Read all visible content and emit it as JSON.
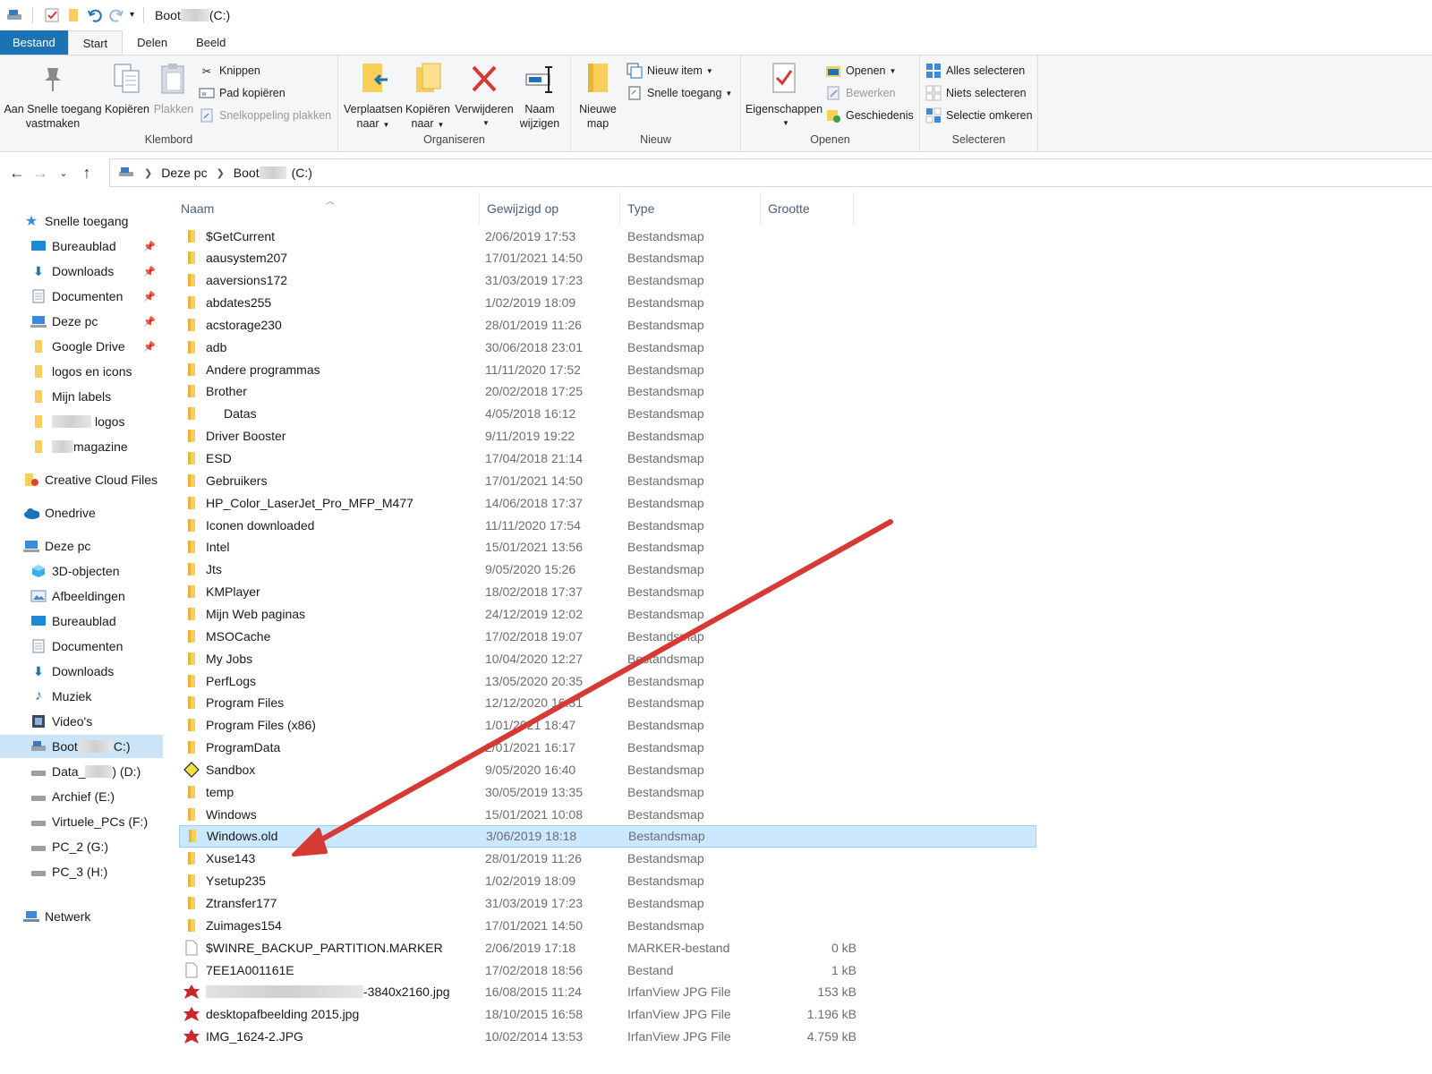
{
  "window": {
    "title_prefix": "Boot",
    "title_suffix": "(C:)"
  },
  "ribbon_tabs": [
    "Bestand",
    "Start",
    "Delen",
    "Beeld"
  ],
  "ribbon": {
    "klembord": {
      "label": "Klembord",
      "pin_line1": "Aan Snelle toegang",
      "pin_line2": "vastmaken",
      "copy": "Kopiëren",
      "paste": "Plakken",
      "cut": "Knippen",
      "copy_path": "Pad kopiëren",
      "paste_shortcut": "Snelkoppeling plakken"
    },
    "organiseren": {
      "label": "Organiseren",
      "move_line1": "Verplaatsen",
      "move_line2": "naar",
      "copyto_line1": "Kopiëren",
      "copyto_line2": "naar",
      "delete": "Verwijderen",
      "rename_line1": "Naam",
      "rename_line2": "wijzigen"
    },
    "nieuw": {
      "label": "Nieuw",
      "newfolder_line1": "Nieuwe",
      "newfolder_line2": "map",
      "new_item": "Nieuw item",
      "easy_access": "Snelle toegang"
    },
    "openen": {
      "label": "Openen",
      "properties": "Eigenschappen",
      "open": "Openen",
      "edit": "Bewerken",
      "history": "Geschiedenis"
    },
    "selecteren": {
      "label": "Selecteren",
      "select_all": "Alles selecteren",
      "select_none": "Niets selecteren",
      "invert": "Selectie omkeren"
    }
  },
  "address": {
    "crumb1": "Deze pc",
    "crumb2_prefix": "Boot",
    "crumb2_suffix": "(C:)"
  },
  "sidebar": {
    "quick_access": "Snelle toegang",
    "quick_items": [
      "Bureaublad",
      "Downloads",
      "Documenten",
      "Deze pc",
      "Google Drive",
      "logos en icons",
      "Mijn labels",
      "logos",
      "magazine"
    ],
    "creative_cloud": "Creative Cloud Files",
    "onedrive": "Onedrive",
    "this_pc": "Deze pc",
    "pc_items": [
      "3D-objecten",
      "Afbeeldingen",
      "Bureaublad",
      "Documenten",
      "Downloads",
      "Muziek",
      "Video's"
    ],
    "drives": [
      "Boot",
      "Data_",
      "Archief (E:)",
      "Virtuele_PCs (F:)",
      "PC_2 (G:)",
      "PC_3 (H:)"
    ],
    "drive_boot_suffix": "C:)",
    "drive_data_suffix": ") (D:)",
    "network": "Netwerk"
  },
  "columns": [
    "Naam",
    "Gewijzigd op",
    "Type",
    "Grootte"
  ],
  "files": [
    {
      "name": "$GetCurrent",
      "date": "2/06/2019 17:53",
      "type": "Bestandsmap",
      "size": ""
    },
    {
      "name": "aausystem207",
      "date": "17/01/2021 14:50",
      "type": "Bestandsmap",
      "size": ""
    },
    {
      "name": "aaversions172",
      "date": "31/03/2019 17:23",
      "type": "Bestandsmap",
      "size": ""
    },
    {
      "name": "abdates255",
      "date": "1/02/2019 18:09",
      "type": "Bestandsmap",
      "size": ""
    },
    {
      "name": "acstorage230",
      "date": "28/01/2019 11:26",
      "type": "Bestandsmap",
      "size": ""
    },
    {
      "name": "adb",
      "date": "30/06/2018 23:01",
      "type": "Bestandsmap",
      "size": ""
    },
    {
      "name": "Andere programmas",
      "date": "11/11/2020 17:52",
      "type": "Bestandsmap",
      "size": ""
    },
    {
      "name": "Brother",
      "date": "20/02/2018 17:25",
      "type": "Bestandsmap",
      "size": ""
    },
    {
      "name": "Datas",
      "date": "4/05/2018 16:12",
      "type": "Bestandsmap",
      "size": ""
    },
    {
      "name": "Driver Booster",
      "date": "9/11/2019 19:22",
      "type": "Bestandsmap",
      "size": ""
    },
    {
      "name": "ESD",
      "date": "17/04/2018 21:14",
      "type": "Bestandsmap",
      "size": ""
    },
    {
      "name": "Gebruikers",
      "date": "17/01/2021 14:50",
      "type": "Bestandsmap",
      "size": ""
    },
    {
      "name": "HP_Color_LaserJet_Pro_MFP_M477",
      "date": "14/06/2018 17:37",
      "type": "Bestandsmap",
      "size": ""
    },
    {
      "name": "Iconen downloaded",
      "date": "11/11/2020 17:54",
      "type": "Bestandsmap",
      "size": ""
    },
    {
      "name": "Intel",
      "date": "15/01/2021 13:56",
      "type": "Bestandsmap",
      "size": ""
    },
    {
      "name": "Jts",
      "date": "9/05/2020 15:26",
      "type": "Bestandsmap",
      "size": ""
    },
    {
      "name": "KMPlayer",
      "date": "18/02/2018 17:37",
      "type": "Bestandsmap",
      "size": ""
    },
    {
      "name": "Mijn Web paginas",
      "date": "24/12/2019 12:02",
      "type": "Bestandsmap",
      "size": ""
    },
    {
      "name": "MSOCache",
      "date": "17/02/2018 19:07",
      "type": "Bestandsmap",
      "size": ""
    },
    {
      "name": "My Jobs",
      "date": "10/04/2020 12:27",
      "type": "Bestandsmap",
      "size": ""
    },
    {
      "name": "PerfLogs",
      "date": "13/05/2020 20:35",
      "type": "Bestandsmap",
      "size": ""
    },
    {
      "name": "Program Files",
      "date": "12/12/2020 16:31",
      "type": "Bestandsmap",
      "size": ""
    },
    {
      "name": "Program Files (x86)",
      "date": "1/01/2021 18:47",
      "type": "Bestandsmap",
      "size": ""
    },
    {
      "name": "ProgramData",
      "date": "2/01/2021 16:17",
      "type": "Bestandsmap",
      "size": ""
    },
    {
      "name": "Sandbox",
      "date": "9/05/2020 16:40",
      "type": "Bestandsmap",
      "size": ""
    },
    {
      "name": "temp",
      "date": "30/05/2019 13:35",
      "type": "Bestandsmap",
      "size": ""
    },
    {
      "name": "Windows",
      "date": "15/01/2021 10:08",
      "type": "Bestandsmap",
      "size": ""
    },
    {
      "name": "Windows.old",
      "date": "3/06/2019 18:18",
      "type": "Bestandsmap",
      "size": ""
    },
    {
      "name": "Xuse143",
      "date": "28/01/2019 11:26",
      "type": "Bestandsmap",
      "size": ""
    },
    {
      "name": "Ysetup235",
      "date": "1/02/2019 18:09",
      "type": "Bestandsmap",
      "size": ""
    },
    {
      "name": "Ztransfer177",
      "date": "31/03/2019 17:23",
      "type": "Bestandsmap",
      "size": ""
    },
    {
      "name": "Zuimages154",
      "date": "17/01/2021 14:50",
      "type": "Bestandsmap",
      "size": ""
    },
    {
      "name": "$WINRE_BACKUP_PARTITION.MARKER",
      "date": "2/06/2019 17:18",
      "type": "MARKER-bestand",
      "size": "0 kB"
    },
    {
      "name": "7EE1A001161E",
      "date": "17/02/2018 18:56",
      "type": "Bestand",
      "size": "1 kB"
    },
    {
      "name": "-3840x2160.jpg",
      "date": "16/08/2015 11:24",
      "type": "IrfanView JPG File",
      "size": "153 kB"
    },
    {
      "name": "desktopafbeelding 2015.jpg",
      "date": "18/10/2015 16:58",
      "type": "IrfanView JPG File",
      "size": "1.196 kB"
    },
    {
      "name": "IMG_1624-2.JPG",
      "date": "10/02/2014 13:53",
      "type": "IrfanView JPG File",
      "size": "4.759 kB"
    }
  ],
  "colors": {
    "accent": "#1a73b5",
    "folder": "#f8cf59",
    "selection": "#cce8ff",
    "arrow": "#d63a35"
  }
}
